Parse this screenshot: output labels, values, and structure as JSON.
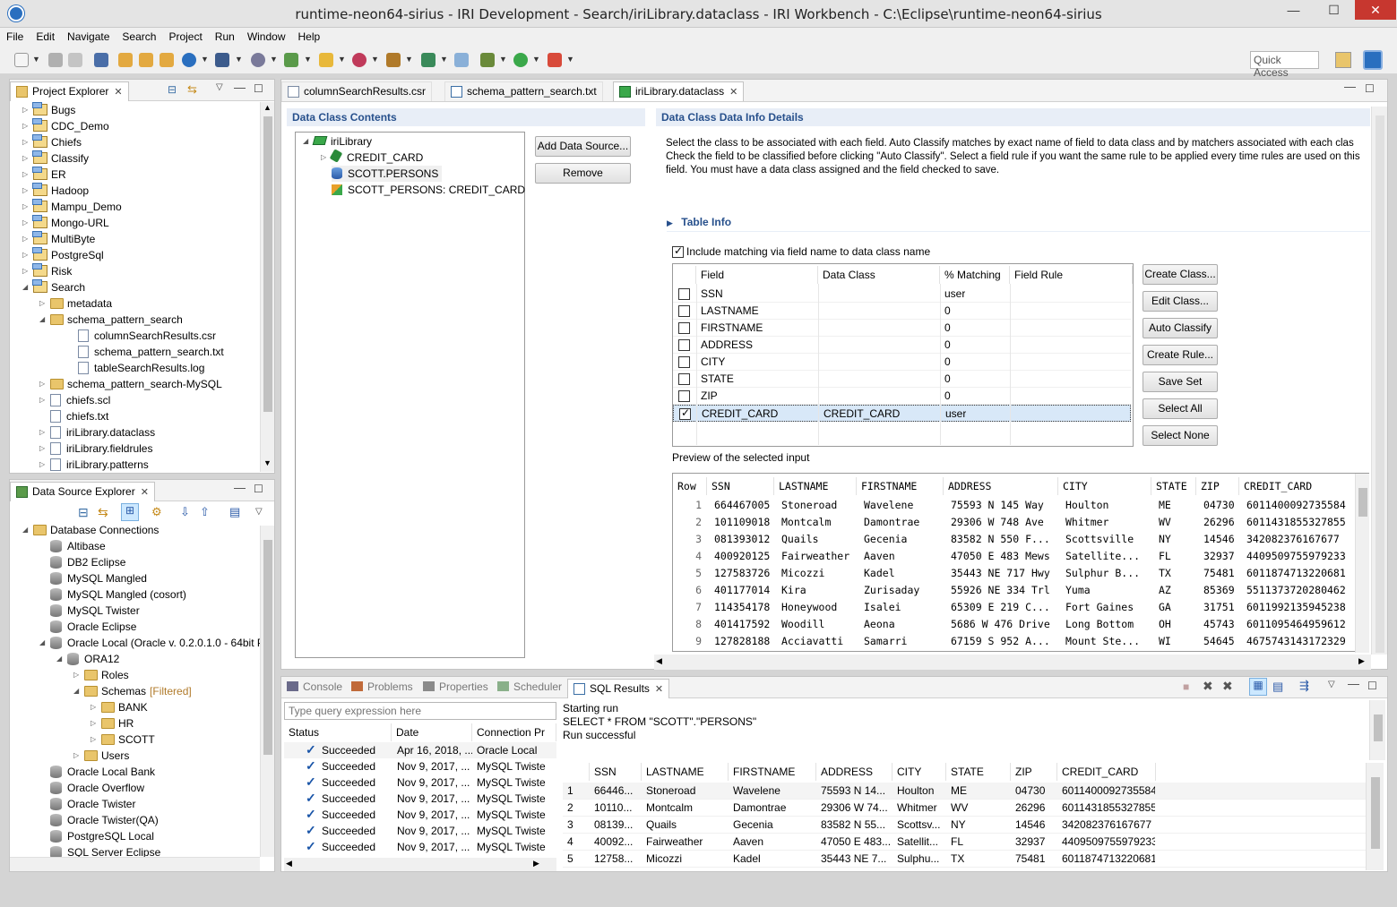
{
  "window": {
    "title": "runtime-neon64-sirius - IRI Development - Search/iriLibrary.dataclass - IRI Workbench - C:\\Eclipse\\runtime-neon64-sirius",
    "minimize": "—",
    "maximize": "☐",
    "close": "✕"
  },
  "menu": [
    "File",
    "Edit",
    "Navigate",
    "Search",
    "Project",
    "Run",
    "Window",
    "Help"
  ],
  "quick_access": "Quick Access",
  "project_explorer": {
    "title": "Project Explorer",
    "items": [
      {
        "label": "Bugs"
      },
      {
        "label": "CDC_Demo"
      },
      {
        "label": "Chiefs"
      },
      {
        "label": "Classify"
      },
      {
        "label": "ER"
      },
      {
        "label": "Hadoop"
      },
      {
        "label": "Mampu_Demo"
      },
      {
        "label": "Mongo-URL"
      },
      {
        "label": "MultiByte"
      },
      {
        "label": "PostgreSql"
      },
      {
        "label": "Risk"
      },
      {
        "label": "Search"
      },
      {
        "label": "metadata"
      },
      {
        "label": "schema_pattern_search"
      },
      {
        "label": "columnSearchResults.csr"
      },
      {
        "label": "schema_pattern_search.txt"
      },
      {
        "label": "tableSearchResults.log"
      },
      {
        "label": "schema_pattern_search-MySQL"
      },
      {
        "label": "chiefs.scl"
      },
      {
        "label": "chiefs.txt"
      },
      {
        "label": "iriLibrary.dataclass"
      },
      {
        "label": "iriLibrary.fieldrules"
      },
      {
        "label": "iriLibrary.patterns"
      }
    ]
  },
  "data_source_explorer": {
    "title": "Data Source Explorer",
    "items": [
      {
        "label": "Database Connections"
      },
      {
        "label": "Altibase"
      },
      {
        "label": "DB2 Eclipse"
      },
      {
        "label": "MySQL Mangled"
      },
      {
        "label": "MySQL Mangled (cosort)"
      },
      {
        "label": "MySQL Twister"
      },
      {
        "label": "Oracle Eclipse"
      },
      {
        "label": "Oracle Local (Oracle v. 0.2.0.1.0 - 64bit Pr"
      },
      {
        "label": "ORA12"
      },
      {
        "label": "Roles"
      },
      {
        "label": "Schemas"
      },
      {
        "label": "BANK"
      },
      {
        "label": "HR"
      },
      {
        "label": "SCOTT"
      },
      {
        "label": "Users"
      },
      {
        "label": "Oracle Local Bank"
      },
      {
        "label": "Oracle Overflow"
      },
      {
        "label": "Oracle Twister"
      },
      {
        "label": "Oracle Twister(QA)"
      },
      {
        "label": "PostgreSQL Local"
      },
      {
        "label": "SQL Server Eclipse"
      }
    ],
    "filtered": "[Filtered]"
  },
  "editor_tabs": [
    "columnSearchResults.csr",
    "schema_pattern_search.txt",
    "iriLibrary.dataclass"
  ],
  "data_class_contents": {
    "title": "Data Class Contents",
    "tree": [
      "iriLibrary",
      "CREDIT_CARD",
      "SCOTT.PERSONS",
      "SCOTT_PERSONS: CREDIT_CARD"
    ],
    "add_button": "Add Data Source...",
    "remove_button": "Remove"
  },
  "details": {
    "title": "Data Class Data Info Details",
    "description": "Select the class to be associated with each field. Auto Classify matches by exact name of field to data class and by matchers associated with each clas Check the field to be classified before clicking \"Auto Classify\". Select a field rule if you want the same rule to be applied every time rules are used on this field. You must have a data class assigned and the field checked to save.",
    "table_info": "Table Info",
    "include_matching": "Include matching via field name to data class name",
    "columns": [
      "Field",
      "Data Class",
      "% Matching",
      "Field Rule"
    ],
    "rows": [
      {
        "field": "SSN",
        "data_class": "",
        "matching": "user",
        "rule": "",
        "checked": false
      },
      {
        "field": "LASTNAME",
        "data_class": "",
        "matching": "0",
        "rule": "",
        "checked": false
      },
      {
        "field": "FIRSTNAME",
        "data_class": "",
        "matching": "0",
        "rule": "",
        "checked": false
      },
      {
        "field": "ADDRESS",
        "data_class": "",
        "matching": "0",
        "rule": "",
        "checked": false
      },
      {
        "field": "CITY",
        "data_class": "",
        "matching": "0",
        "rule": "",
        "checked": false
      },
      {
        "field": "STATE",
        "data_class": "",
        "matching": "0",
        "rule": "",
        "checked": false
      },
      {
        "field": "ZIP",
        "data_class": "",
        "matching": "0",
        "rule": "",
        "checked": false
      },
      {
        "field": "CREDIT_CARD",
        "data_class": "CREDIT_CARD",
        "matching": "user",
        "rule": "",
        "checked": true
      }
    ],
    "buttons": [
      "Create Class...",
      "Edit Class...",
      "Auto Classify",
      "Create Rule...",
      "Save Set",
      "Select All",
      "Select None"
    ],
    "preview_label": "Preview of the selected input",
    "preview_columns": [
      "Row",
      "SSN",
      "LASTNAME",
      "FIRSTNAME",
      "ADDRESS",
      "CITY",
      "STATE",
      "ZIP",
      "CREDIT_CARD"
    ],
    "preview_rows": [
      [
        "1",
        "664467005",
        "Stoneroad",
        "Wavelene",
        "75593 N 145 Way",
        "Houlton",
        "ME",
        "04730",
        "6011400092735584"
      ],
      [
        "2",
        "101109018",
        "Montcalm",
        "Damontrae",
        "29306 W 748 Ave",
        "Whitmer",
        "WV",
        "26296",
        "6011431855327855"
      ],
      [
        "3",
        "081393012",
        "Quails",
        "Gecenia",
        "83582 N 550 F...",
        "Scottsville",
        "NY",
        "14546",
        "342082376167677"
      ],
      [
        "4",
        "400920125",
        "Fairweather",
        "Aaven",
        "47050 E 483 Mews",
        "Satellite...",
        "FL",
        "32937",
        "4409509755979233"
      ],
      [
        "5",
        "127583726",
        "Micozzi",
        "Kadel",
        "35443 NE 717 Hwy",
        "Sulphur B...",
        "TX",
        "75481",
        "6011874713220681"
      ],
      [
        "6",
        "401177014",
        "Kira",
        "Zurisaday",
        "55926 NE 334 Trl",
        "Yuma",
        "AZ",
        "85369",
        "5511373720280462"
      ],
      [
        "7",
        "114354178",
        "Honeywood",
        "Isalei",
        "65309 E 219 C...",
        "Fort Gaines",
        "GA",
        "31751",
        "6011992135945238"
      ],
      [
        "8",
        "401417592",
        "Woodill",
        "Aeona",
        "5686 W 476 Drive",
        "Long Bottom",
        "OH",
        "45743",
        "6011095464959612"
      ],
      [
        "9",
        "127828188",
        "Acciavatti",
        "Samarri",
        "67159 S 952 A...",
        "Mount Ste...",
        "WI",
        "54645",
        "4675743143172329"
      ]
    ]
  },
  "bottom": {
    "tabs": [
      "Console",
      "Problems",
      "Properties",
      "Scheduler",
      "SQL Results"
    ],
    "query_placeholder": "Type query expression here",
    "history_columns": [
      "Status",
      "Date",
      "Connection Pr"
    ],
    "history": [
      [
        "Succeeded",
        "Apr 16, 2018, ...",
        "Oracle Local"
      ],
      [
        "Succeeded",
        "Nov 9, 2017, ...",
        "MySQL Twiste"
      ],
      [
        "Succeeded",
        "Nov 9, 2017, ...",
        "MySQL Twiste"
      ],
      [
        "Succeeded",
        "Nov 9, 2017, ...",
        "MySQL Twiste"
      ],
      [
        "Succeeded",
        "Nov 9, 2017, ...",
        "MySQL Twiste"
      ],
      [
        "Succeeded",
        "Nov 9, 2017, ...",
        "MySQL Twiste"
      ],
      [
        "Succeeded",
        "Nov 9, 2017, ...",
        "MySQL Twiste"
      ]
    ],
    "log": [
      "Starting run",
      "SELECT * FROM \"SCOTT\".\"PERSONS\"",
      "Run successful"
    ],
    "result_columns": [
      "",
      "SSN",
      "LASTNAME",
      "FIRSTNAME",
      "ADDRESS",
      "CITY",
      "STATE",
      "ZIP",
      "CREDIT_CARD"
    ],
    "result_rows": [
      [
        "1",
        "66446...",
        "Stoneroad",
        "Wavelene",
        "75593 N 14...",
        "Houlton",
        "ME",
        "04730",
        "6011400092735584"
      ],
      [
        "2",
        "10110...",
        "Montcalm",
        "Damontrae",
        "29306 W 74...",
        "Whitmer",
        "WV",
        "26296",
        "6011431855327855"
      ],
      [
        "3",
        "08139...",
        "Quails",
        "Gecenia",
        "83582 N 55...",
        "Scottsv...",
        "NY",
        "14546",
        "342082376167677"
      ],
      [
        "4",
        "40092...",
        "Fairweather",
        "Aaven",
        "47050 E 483...",
        "Satellit...",
        "FL",
        "32937",
        "4409509755979233"
      ],
      [
        "5",
        "12758...",
        "Micozzi",
        "Kadel",
        "35443 NE 7...",
        "Sulphu...",
        "TX",
        "75481",
        "6011874713220681"
      ]
    ]
  },
  "colors": {
    "accent": "#27508c",
    "selection": "#cce8ff",
    "close": "#c7372f"
  }
}
